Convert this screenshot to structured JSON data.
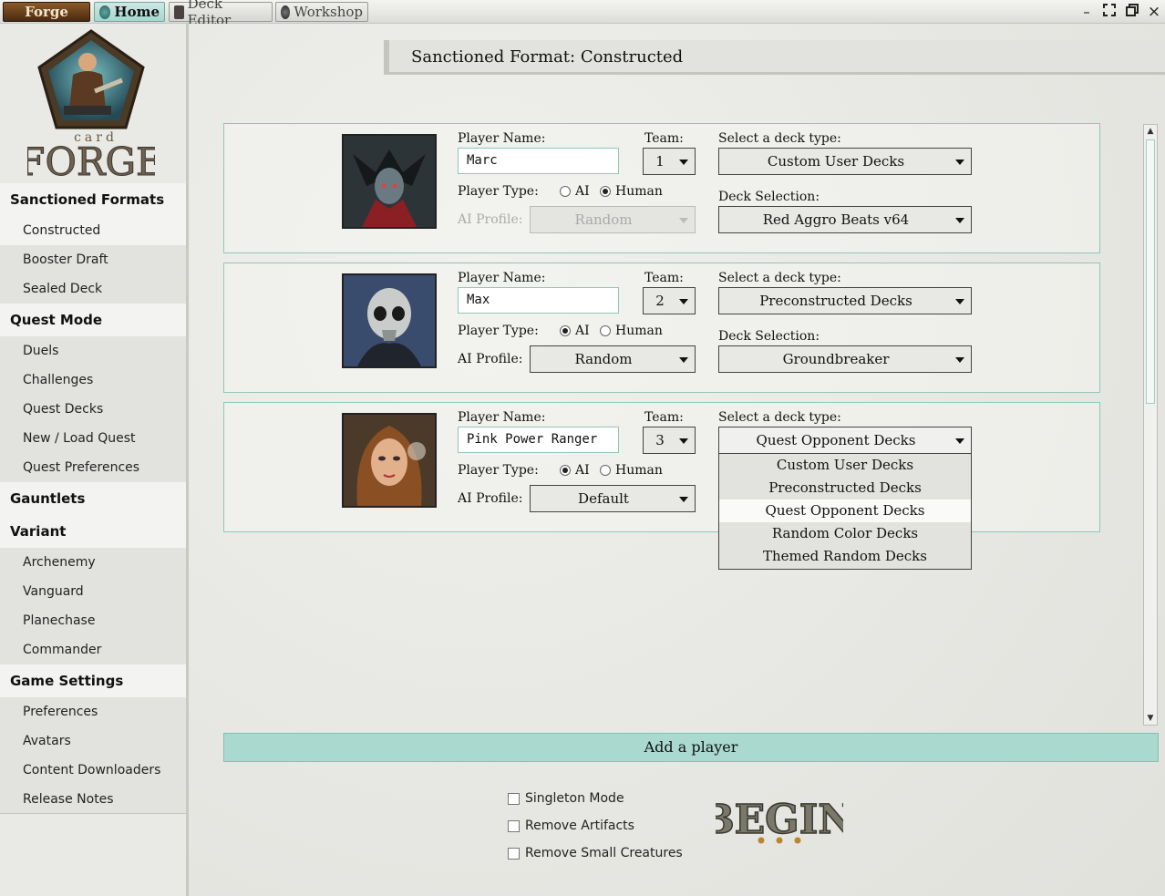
{
  "titlebar": {
    "forge": "Forge",
    "tabs": [
      {
        "label": "Home",
        "icon": "home-icon"
      },
      {
        "label": "Deck Editor",
        "icon": "deck-editor-icon"
      },
      {
        "label": "Workshop",
        "icon": "workshop-icon"
      }
    ]
  },
  "sidebar": {
    "sections": {
      "sanctioned": "Sanctioned Formats",
      "quest": "Quest Mode",
      "gauntlets": "Gauntlets",
      "variant": "Variant",
      "settings": "Game Settings"
    },
    "sanctioned_items": [
      "Constructed",
      "Booster Draft",
      "Sealed Deck"
    ],
    "quest_items": [
      "Duels",
      "Challenges",
      "Quest Decks",
      "New / Load Quest",
      "Quest Preferences"
    ],
    "variant_items": [
      "Archenemy",
      "Vanguard",
      "Planechase",
      "Commander"
    ],
    "settings_items": [
      "Preferences",
      "Avatars",
      "Content Downloaders",
      "Release Notes"
    ]
  },
  "main": {
    "title": "Sanctioned Format: Constructed",
    "labels": {
      "player_name": "Player Name:",
      "team": "Team:",
      "deck_type": "Select a deck type:",
      "player_type": "Player Type:",
      "ai": "AI",
      "human": "Human",
      "ai_profile": "AI Profile:",
      "deck_selection": "Deck Selection:"
    },
    "players": [
      {
        "name": "Marc",
        "team": "1",
        "type": "Human",
        "ai_profile": "Random",
        "deck_type": "Custom User Decks",
        "deck": "Red Aggro Beats v64"
      },
      {
        "name": "Max",
        "team": "2",
        "type": "AI",
        "ai_profile": "Random",
        "deck_type": "Preconstructed Decks",
        "deck": "Groundbreaker"
      },
      {
        "name": "Pink Power Ranger",
        "team": "3",
        "type": "AI",
        "ai_profile": "Default",
        "deck_type": "Quest Opponent Decks",
        "deck": ""
      }
    ],
    "deck_type_options": [
      "Custom User Decks",
      "Preconstructed Decks",
      "Quest Opponent Decks",
      "Random Color Decks",
      "Themed Random Decks"
    ],
    "highlighted_option": "Quest Opponent Decks",
    "add_player": "Add a player",
    "options": [
      "Singleton Mode",
      "Remove Artifacts",
      "Remove Small Creatures"
    ],
    "begin": "BEGIN"
  },
  "colors": {
    "accent": "#a9d9cf",
    "border": "#8fc7bc"
  }
}
